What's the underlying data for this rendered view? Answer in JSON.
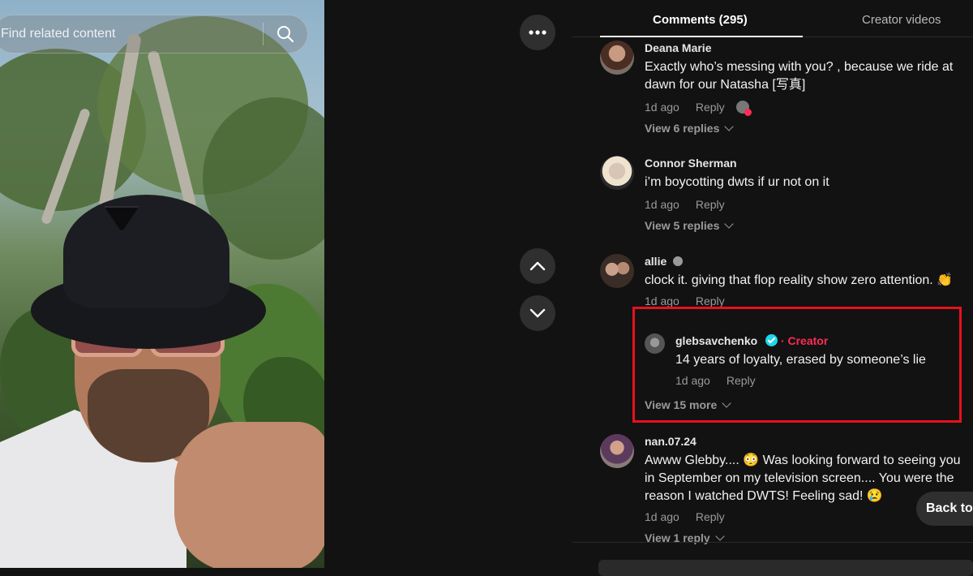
{
  "search": {
    "placeholder": "Find related content"
  },
  "icons": {
    "search": "search-icon",
    "more": "more-horizontal-icon",
    "previous": "chevron-up-icon",
    "next": "chevron-down-icon"
  },
  "tabs": {
    "comments": "Comments (295)",
    "creator_videos": "Creator videos"
  },
  "comments": [
    {
      "user": "Deana Marie",
      "text": "Exactly who’s messing with you? , because we ride at dawn for our Natasha [写真]",
      "time": "1d ago",
      "reply": "Reply",
      "view_replies": "View 6 replies"
    },
    {
      "user": "Connor Sherman",
      "text": "i’m boycotting dwts if ur not on it",
      "time": "1d ago",
      "reply": "Reply",
      "view_replies": "View 5 replies"
    },
    {
      "user": "allie",
      "text": "clock it. giving that flop reality show zero attention. 👏",
      "time": "1d ago",
      "reply": "Reply",
      "sub_reply": {
        "user": "glebsavchenko",
        "badge": "· Creator",
        "text": "14 years of loyalty, erased by someone’s lie",
        "time": "1d ago",
        "reply": "Reply"
      },
      "view_more": "View 15 more"
    },
    {
      "user": "nan.07.24",
      "text": "Awww Glebby.... 😳 Was looking forward to seeing you in September on my television screen.... You were the reason I watched DWTS! Feeling sad! 😢",
      "time": "1d ago",
      "reply": "Reply",
      "view_replies": "View 1 reply"
    }
  ],
  "back_to_top": "Back to top",
  "colors": {
    "creator": "#fe2c55",
    "verified": "#20d5ec",
    "highlight": "#e8101c"
  }
}
